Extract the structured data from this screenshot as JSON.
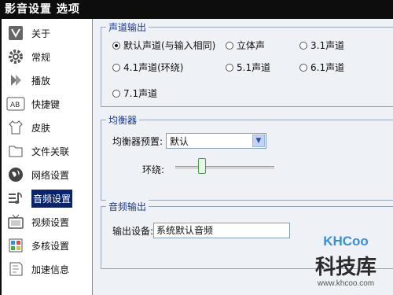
{
  "window": {
    "title": "影音设置 选项"
  },
  "sidebar": {
    "items": [
      {
        "label": "关于",
        "icon": "about-book-icon"
      },
      {
        "label": "常规",
        "icon": "gear-icon"
      },
      {
        "label": "播放",
        "icon": "play-arrow-icon"
      },
      {
        "label": "快捷键",
        "icon": "keyboard-ab-icon"
      },
      {
        "label": "皮肤",
        "icon": "shirt-icon"
      },
      {
        "label": "文件关联",
        "icon": "folder-icon"
      },
      {
        "label": "网络设置",
        "icon": "globe-icon"
      },
      {
        "label": "音频设置",
        "icon": "audio-note-icon",
        "active": true
      },
      {
        "label": "视频设置",
        "icon": "tv-icon"
      },
      {
        "label": "多核设置",
        "icon": "cpu-icon"
      },
      {
        "label": "加速信息",
        "icon": "accelerate-icon"
      }
    ]
  },
  "channel_output": {
    "title": "声道输出",
    "options": [
      {
        "label": "默认声道(与输入相同)",
        "selected": true
      },
      {
        "label": "立体声",
        "selected": false
      },
      {
        "label": "3.1声道",
        "selected": false
      },
      {
        "label": "4.1声道(环绕)",
        "selected": false
      },
      {
        "label": "5.1声道",
        "selected": false
      },
      {
        "label": "6.1声道",
        "selected": false
      },
      {
        "label": "7.1声道",
        "selected": false
      }
    ]
  },
  "equalizer": {
    "title": "均衡器",
    "preset_label": "均衡器预置:",
    "preset_value": "默认",
    "surround_label": "环绕:",
    "surround_level": 0.25
  },
  "audio_output": {
    "title": "音频输出",
    "device_label": "输出设备:",
    "device_value": "系统默认音频"
  },
  "watermark": {
    "logo": "KHCoo",
    "name": "科技库",
    "url": "www.khcoo.com"
  },
  "colors": {
    "title_bar": "#0d0d0d",
    "selection": "#0a246a",
    "group_title": "#1a3a8c",
    "panel_bg": "#eef1f5",
    "watermark_blue": "#3a8fd6"
  }
}
